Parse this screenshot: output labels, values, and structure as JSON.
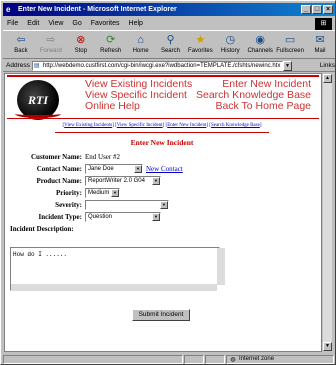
{
  "window": {
    "title": "Enter New Incident - Microsoft Internet Explorer"
  },
  "menu": [
    "File",
    "Edit",
    "View",
    "Go",
    "Favorites",
    "Help"
  ],
  "toolbar": [
    {
      "label": "Back",
      "icon": "back-arrow-icon",
      "glyph": "⇦",
      "disabled": false
    },
    {
      "label": "Forward",
      "icon": "forward-arrow-icon",
      "glyph": "⇨",
      "disabled": true
    },
    {
      "label": "Stop",
      "icon": "stop-icon",
      "glyph": "⊗",
      "disabled": false
    },
    {
      "label": "Refresh",
      "icon": "refresh-icon",
      "glyph": "⟳",
      "disabled": false
    },
    {
      "label": "Home",
      "icon": "home-icon",
      "glyph": "⌂",
      "disabled": false
    },
    {
      "label": "Search",
      "icon": "search-icon",
      "glyph": "⚲",
      "disabled": false
    },
    {
      "label": "Favorites",
      "icon": "favorites-icon",
      "glyph": "★",
      "disabled": false
    },
    {
      "label": "History",
      "icon": "history-icon",
      "glyph": "◷",
      "disabled": false
    },
    {
      "label": "Channels",
      "icon": "channels-icon",
      "glyph": "◉",
      "disabled": false
    },
    {
      "label": "Fullscreen",
      "icon": "fullscreen-icon",
      "glyph": "▭",
      "disabled": false
    },
    {
      "label": "Mail",
      "icon": "mail-icon",
      "glyph": "✉",
      "disabled": false
    }
  ],
  "address": {
    "label": "Address",
    "url": "http://webdemo.custfirst.com/cgi-bin/iwcgi.exe?iwdbaction=TEMPLATE./cfshts/newinc.htx",
    "links_label": "Links"
  },
  "logo_text": "RTI",
  "nav_big": {
    "left": [
      "View Existing Incidents",
      "View Specific Incident",
      "Online Help"
    ],
    "right": [
      "Enter New Incident",
      "Search Knowledge Base",
      "Back To Home Page"
    ]
  },
  "small_links": [
    "View Existing Incidents",
    "View Specific Incident",
    "Enter New Incident",
    "Search Knowledge Base"
  ],
  "page_title": "Enter New Incident",
  "form": {
    "customer_label": "Customer Name:",
    "customer_value": "End User #2",
    "contact_label": "Contact Name:",
    "contact_value": "Jane Doe",
    "new_contact": "New Contact",
    "product_label": "Product Name:",
    "product_value": "ReportWriter 2.0 G04",
    "priority_label": "Priority:",
    "priority_value": "Medium",
    "severity_label": "Severity:",
    "severity_value": "",
    "type_label": "Incident Type:",
    "type_value": "Question",
    "description_label": "Incident Description:",
    "description_value": "How do I ......",
    "submit_label": "Submit Incident"
  },
  "status": {
    "zone": "Internet zone"
  },
  "colors": {
    "nav_red": "#cc3333",
    "title_blue": "#000080",
    "link_blue": "#0000cc"
  }
}
